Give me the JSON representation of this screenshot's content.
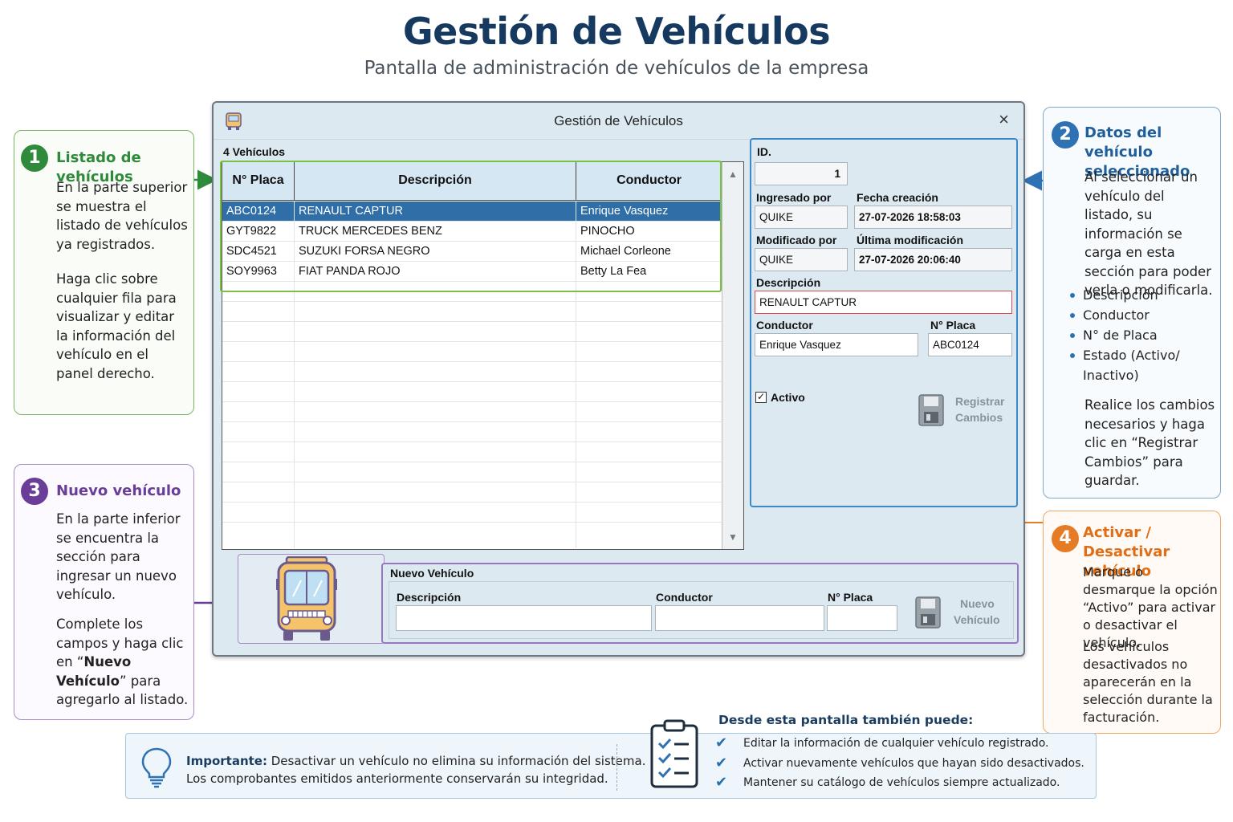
{
  "header": {
    "title": "Gestión de Vehículos",
    "subtitle": "Pantalla de administración de vehículos de la empresa"
  },
  "callouts": {
    "listado": {
      "number": "1",
      "title": "Listado de vehículos",
      "text1": "En la parte superior se muestra el listado de vehículos ya registrados.",
      "text2": "Haga clic sobre cualquier fila para visualizar y editar la información del vehículo en el panel derecho."
    },
    "datos": {
      "number": "2",
      "title": "Datos del vehículo seleccionado",
      "text1": "Al seleccionar un vehículo del listado, su información se carga en esta sección para poder verla o modificarla.",
      "bullets": [
        "Descripción",
        "Conductor",
        "N° de Placa",
        "Estado (Activo/ Inactivo)"
      ],
      "text2": "Realice los cambios necesarios y haga clic en “Registrar Cambios” para guardar."
    },
    "nuevo": {
      "number": "3",
      "title": "Nuevo vehículo",
      "text1": "En la parte inferior se encuentra la sección para ingresar un nuevo vehículo.",
      "text2_pre": "Complete los campos y haga clic en “",
      "text2_bold": "Nuevo Vehículo",
      "text2_post": "” para agregarlo al listado."
    },
    "activar": {
      "number": "4",
      "title": "Activar / Desactivar vehículo",
      "text1": "Marque o desmarque la opción “Activo” para activar o desactivar el vehículo.",
      "text2": "Los vehículos desactivados no aparecerán en la selección durante la facturación."
    }
  },
  "window": {
    "title": "Gestión de Vehículos",
    "close_glyph": "×",
    "count_label": "4 Vehículos",
    "columns": [
      "N° Placa",
      "Descripción",
      "Conductor"
    ],
    "rows": [
      {
        "placa": "ABC0124",
        "descripcion": "RENAULT CAPTUR",
        "conductor": "Enrique Vasquez"
      },
      {
        "placa": "GYT9822",
        "descripcion": "TRUCK MERCEDES BENZ",
        "conductor": "PINOCHO"
      },
      {
        "placa": "SDC4521",
        "descripcion": "SUZUKI FORSA NEGRO",
        "conductor": "Michael Corleone"
      },
      {
        "placa": "SOY9963",
        "descripcion": "FIAT PANDA ROJO",
        "conductor": "Betty La Fea"
      }
    ],
    "selected_row": 0,
    "scroll_up": "▲",
    "scroll_down": "▼",
    "detail": {
      "id_label": "ID.",
      "id_value": "1",
      "ingresado_label": "Ingresado por",
      "ingresado_value": "QUIKE",
      "fecha_creacion_label": "Fecha creación",
      "fecha_creacion_value": "27-07-2026 18:58:03",
      "modificado_label": "Modificado por",
      "modificado_value": "QUIKE",
      "ultima_mod_label": "Última modificación",
      "ultima_mod_value": "27-07-2026 20:06:40",
      "descripcion_label": "Descripción",
      "descripcion_value": "RENAULT CAPTUR",
      "conductor_label": "Conductor",
      "conductor_value": "Enrique Vasquez",
      "placa_label": "N° Placa",
      "placa_value": "ABC0124",
      "activo_label": "Activo",
      "activo_checked": true,
      "check_glyph": "✓",
      "save_label_1": "Registrar",
      "save_label_2": "Cambios"
    },
    "new_vehicle": {
      "section_title": "Nuevo Vehículo",
      "descripcion_label": "Descripción",
      "conductor_label": "Conductor",
      "placa_label": "N° Placa",
      "descripcion_value": "",
      "conductor_value": "",
      "placa_value": "",
      "button_label_1": "Nuevo",
      "button_label_2": "Vehículo"
    }
  },
  "bottom": {
    "important_label": "Importante:",
    "important_text1": " Desactivar un vehículo no elimina su información del sistema.",
    "important_text2": "Los comprobantes emitidos anteriormente conservarán su integridad.",
    "also_title": "Desde esta pantalla también puede:",
    "check_glyph": "✔",
    "also_items": [
      "Editar la información de cualquier vehículo registrado.",
      "Activar nuevamente vehículos que hayan sido desactivados.",
      "Mantener su catálogo de vehículos siempre actualizado."
    ]
  },
  "colors": {
    "title": "#163a5f",
    "green": "#2f8a3c",
    "purple": "#6a3d99",
    "blue": "#2f72b4",
    "orange": "#e57c25",
    "selected_row": "#2f6ea6",
    "window_bg": "#dde9f1"
  },
  "icons": [
    "bus-icon",
    "close-icon",
    "floppy-disk-icon",
    "lightbulb-icon",
    "clipboard-checklist-icon",
    "check-icon",
    "arrow-icon"
  ]
}
